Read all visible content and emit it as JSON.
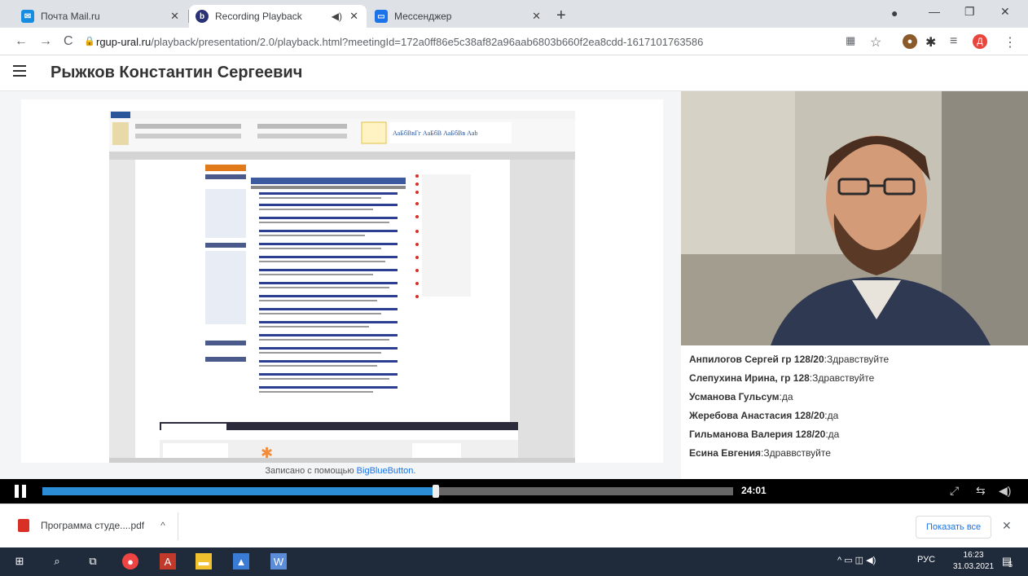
{
  "browser": {
    "tabs": [
      {
        "title": "Почта Mail.ru",
        "icon": "mail-icon",
        "color": "#168de2"
      },
      {
        "title": "Recording Playback",
        "icon": "bbb-icon",
        "color": "#283274"
      },
      {
        "title": "Мессенджер",
        "icon": "chat-icon",
        "color": "#1a73e8"
      }
    ],
    "url_host": "rgup-ural.ru",
    "url_path": "/playback/presentation/2.0/playback.html?meetingId=172a0ff86e5c38af82a96aab6803b660f2ea8cdd-1617101763586",
    "profile_initial": "Д"
  },
  "page": {
    "presenter_name": "Рыжков Константин Сергеевич",
    "recorded_with": "Записано с помощью",
    "recorded_link": "BigBlueButton",
    "recorded_suffix": "."
  },
  "chat": [
    {
      "name": "Анпилогов Сергей гр 128/20",
      "message": "Здравствуйте"
    },
    {
      "name": "Слепухина Ирина, гр 128",
      "message": "Здравствуйте"
    },
    {
      "name": "Усманова Гульсум",
      "message": "да"
    },
    {
      "name": "Жеребова Анастасия 128/20",
      "message": "да"
    },
    {
      "name": "Гильманова Валерия 128/20",
      "message": "да"
    },
    {
      "name": "Есина Евгения",
      "message": "Здраввствуйте"
    }
  ],
  "player": {
    "time": "24:01",
    "progress": 0.57
  },
  "downloads": {
    "file": "Программа студе....pdf",
    "show_all": "Показать все"
  },
  "taskbar": {
    "lang": "РУС",
    "time": "16:23",
    "date": "31.03.2021",
    "notifications": "5"
  },
  "colors": {
    "accent": "#1a73e8",
    "progress_fill": "#2b8dd6",
    "word_ribbon": "#2b579a"
  }
}
